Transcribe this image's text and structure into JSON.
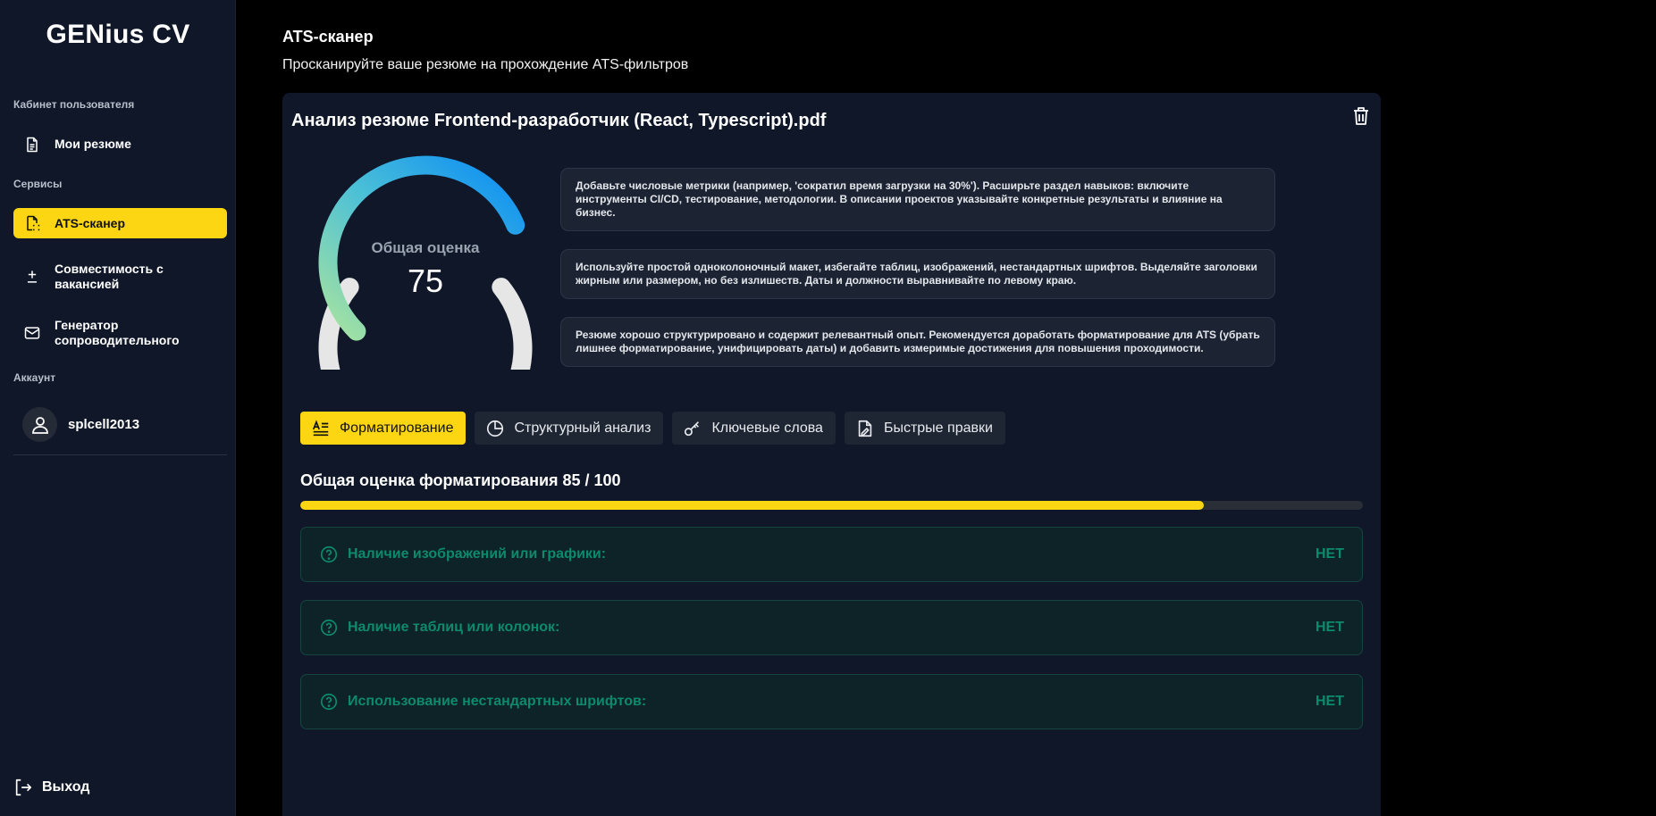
{
  "app": {
    "brand": "GENius CV"
  },
  "sidebar": {
    "section_cabinet": "Кабинет пользователя",
    "section_services": "Сервисы",
    "section_account": "Аккаунт",
    "items": [
      {
        "label": "Мои резюме",
        "icon": "document-icon"
      },
      {
        "label": "ATS-сканер",
        "icon": "file-scan-icon",
        "active": true
      },
      {
        "label": "Совместимость с вакансией",
        "icon": "plus-minus-icon"
      },
      {
        "label": "Генератор сопроводительного",
        "icon": "mail-icon"
      }
    ],
    "user": {
      "name": "splcell2013",
      "icon": "user-icon"
    },
    "logout": "Выход"
  },
  "header": {
    "title": "ATS-сканер",
    "subtitle": "Просканируйте ваше резюме на прохождение ATS-фильтров"
  },
  "analysis": {
    "title": "Анализ резюме Frontend-разработчик (React, Typescript).pdf",
    "score_label": "Общая оценка",
    "score": "75",
    "score_value": 75,
    "recommendations": [
      "Добавьте числовые метрики (например, 'сократил время загрузки на 30%'). Расширьте раздел навыков: включите инструменты CI/CD, тестирование, методологии. В описании проектов указывайте конкретные результаты и влияние на бизнес.",
      "Используйте простой одноколоночный макет, избегайте таблиц, изображений, нестандартных шрифтов. Выделяйте заголовки жирным или размером, но без излишеств. Даты и должности выравнивайте по левому краю.",
      "Резюме хорошо структурировано и содержит релевантный опыт. Рекомендуется доработать форматирование для ATS (убрать лишнее форматирование, унифицировать даты) и добавить измеримые достижения для повышения проходимости."
    ]
  },
  "tabs": [
    {
      "label": "Форматирование",
      "icon": "text-align-icon",
      "active": true
    },
    {
      "label": "Структурный анализ",
      "icon": "pie-chart-icon"
    },
    {
      "label": "Ключевые слова",
      "icon": "key-icon"
    },
    {
      "label": "Быстрые правки",
      "icon": "file-edit-icon"
    }
  ],
  "formatting": {
    "title": "Общая оценка форматирования 85 / 100",
    "progress_percent": 85,
    "checks": [
      {
        "label": "Наличие изображений или графики:",
        "value": "НЕТ"
      },
      {
        "label": "Наличие таблиц или колонок:",
        "value": "НЕТ"
      },
      {
        "label": "Использование нестандартных шрифтов:",
        "value": "НЕТ"
      }
    ]
  },
  "colors": {
    "accent": "#fcd612",
    "sidebar_bg": "#0f1729",
    "check_text": "#0d8a6d"
  }
}
